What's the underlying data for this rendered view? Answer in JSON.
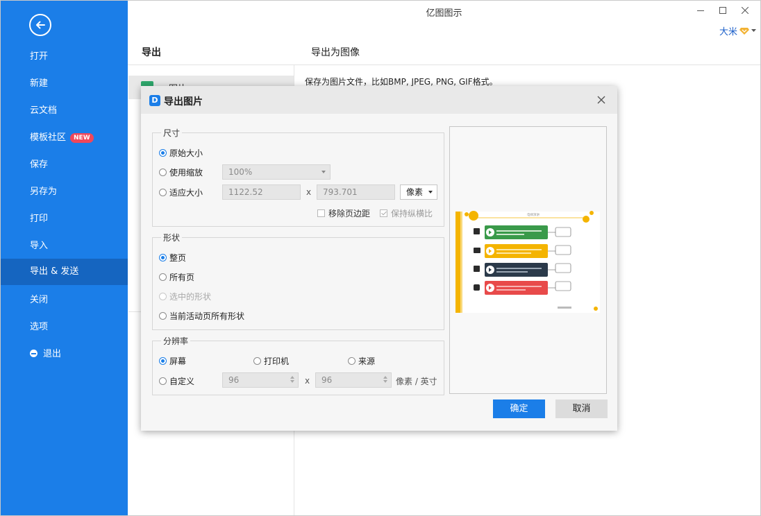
{
  "app": {
    "title": "亿图图示",
    "user_name": "大米"
  },
  "sidebar": {
    "items": [
      {
        "label": "打开"
      },
      {
        "label": "新建"
      },
      {
        "label": "云文档"
      },
      {
        "label": "模板社区",
        "badge": "NEW"
      },
      {
        "label": "保存"
      },
      {
        "label": "另存为"
      },
      {
        "label": "打印"
      },
      {
        "label": "导入"
      },
      {
        "label": "导出 & 发送"
      },
      {
        "label": "关闭"
      },
      {
        "label": "选项"
      },
      {
        "label": "退出"
      }
    ],
    "active_index": 8
  },
  "panel": {
    "left_header": "导出",
    "right_header": "导出为图像",
    "selected_item": "图片",
    "description": "保存为图片文件，比如BMP, JPEG, PNG, GIF格式。"
  },
  "dialog": {
    "title": "导出图片",
    "size_group": {
      "legend": "尺寸",
      "original_size": "原始大小",
      "use_zoom": "使用缩放",
      "zoom_value": "100%",
      "fit_size": "适应大小",
      "width": "1122.52",
      "height": "793.701",
      "x_sep": "x",
      "unit": "像素",
      "remove_margin": "移除页边距",
      "keep_ratio": "保持纵横比",
      "selected": "original_size"
    },
    "shape_group": {
      "legend": "形状",
      "whole_page": "整页",
      "all_pages": "所有页",
      "selected_shapes": "选中的形状",
      "current_page_shapes": "当前活动页所有形状",
      "selected": "whole_page"
    },
    "resolution_group": {
      "legend": "分辨率",
      "screen": "屏幕",
      "printer": "打印机",
      "source": "来源",
      "custom": "自定义",
      "dpi_x": "96",
      "dpi_y": "96",
      "x_sep": "x",
      "unit": "像素 / 英寸",
      "selected": "screen"
    },
    "ok_label": "确定",
    "cancel_label": "取消"
  },
  "colors": {
    "sidebar": "#1b7ee8",
    "accent": "#1b7ee8",
    "badge": "#f0475a",
    "preview_green": "#3a9a4a",
    "preview_yellow": "#f4b400",
    "preview_dark": "#2b3a4a",
    "preview_red": "#e84a4a"
  },
  "preview": {
    "title": "电梯演讲",
    "rows": [
      {
        "icon": "train-icon",
        "color": "#3a9a4a"
      },
      {
        "icon": "binoculars-icon",
        "color": "#f4b400"
      },
      {
        "icon": "gift-icon",
        "color": "#2b3a4a"
      },
      {
        "icon": "car-icon",
        "color": "#e84a4a"
      }
    ]
  }
}
